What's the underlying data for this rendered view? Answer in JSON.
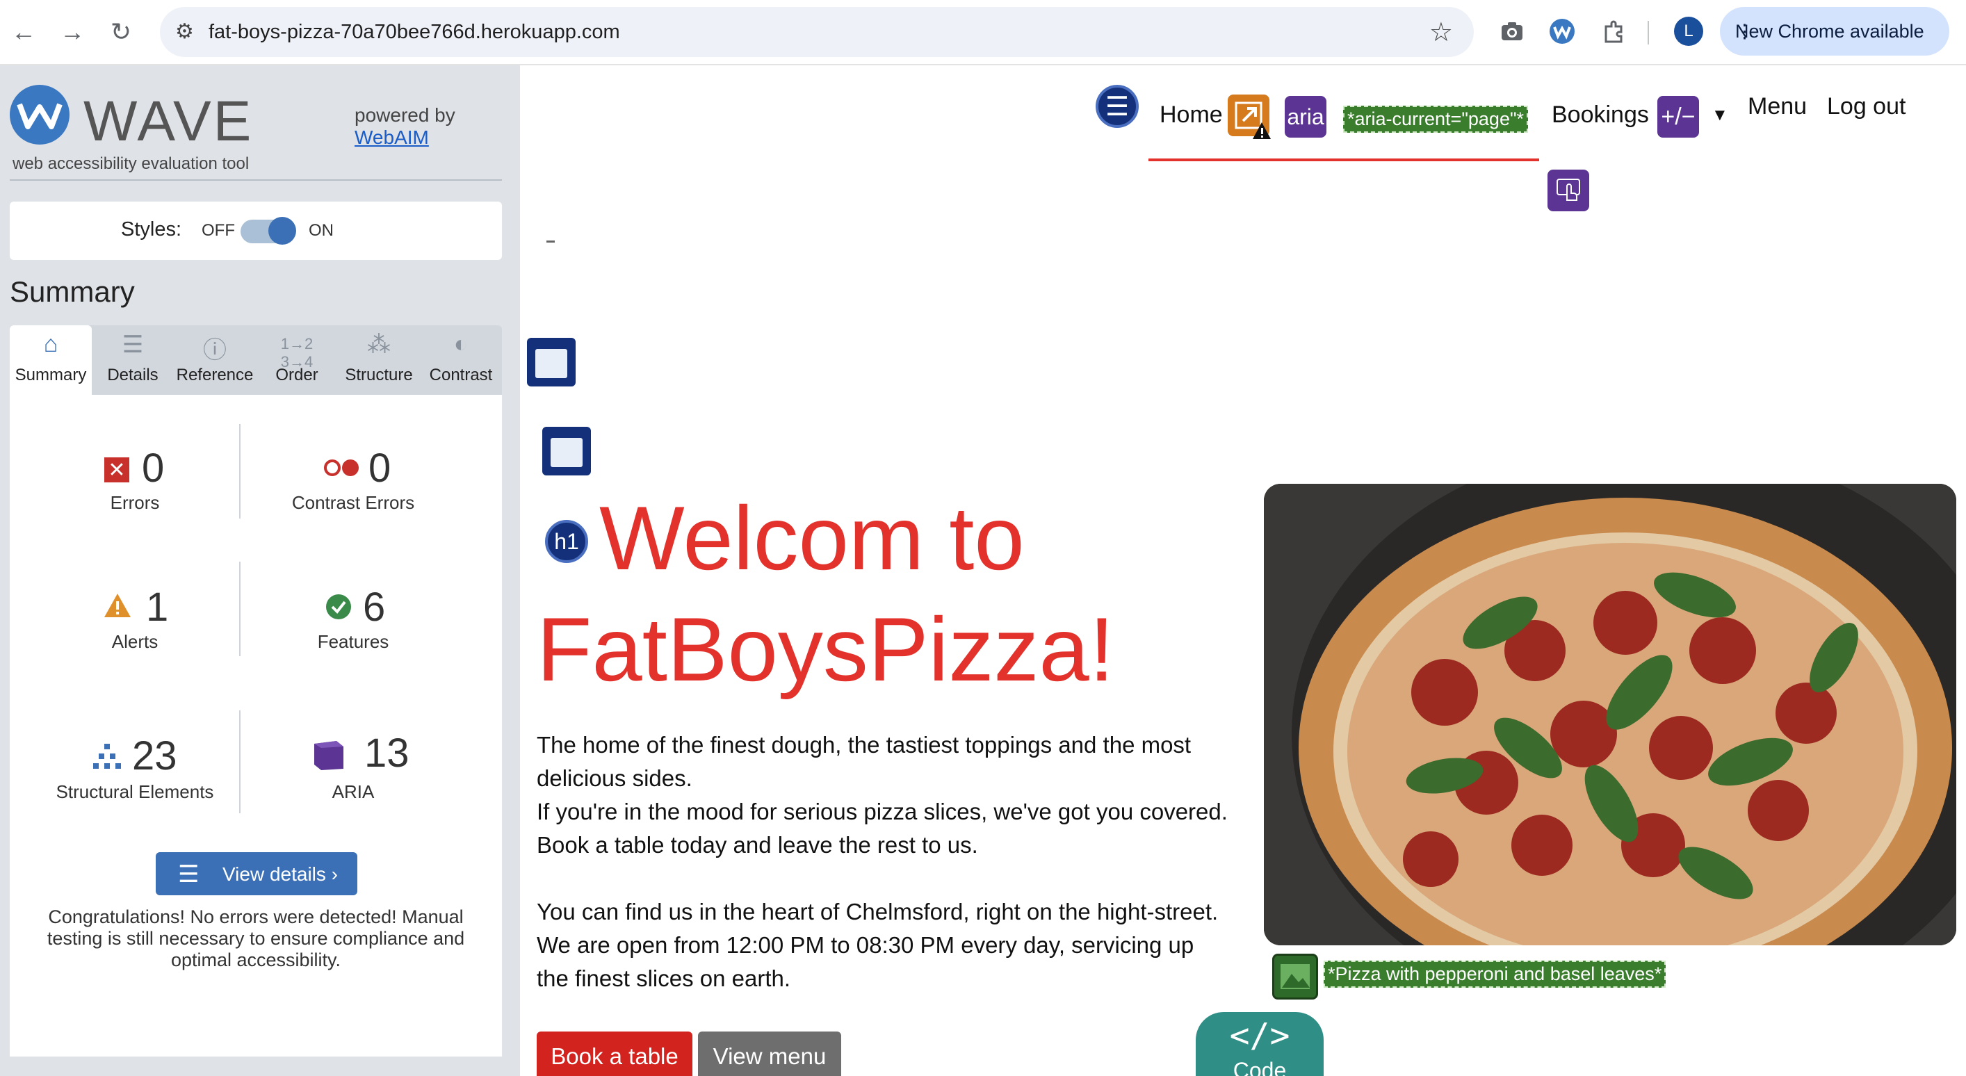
{
  "browser": {
    "url": "fat-boys-pizza-70a70bee766d.herokuapp.com",
    "profile_initial": "L",
    "update_label": "New Chrome available",
    "icons": [
      "back-icon",
      "forward-icon",
      "reload-icon",
      "site-settings-icon",
      "bookmark-star-icon",
      "screenshot-icon",
      "wave-extension-icon",
      "extensions-icon",
      "kebab-menu-icon"
    ]
  },
  "wave": {
    "title": "WAVE",
    "subtitle": "web accessibility evaluation tool",
    "powered_by": "powered by",
    "webaim": "WebAIM",
    "styles_label": "Styles:",
    "styles_off": "OFF",
    "styles_on": "ON",
    "styles_enabled": true,
    "summary_heading": "Summary",
    "tabs": [
      {
        "label": "Summary",
        "icon": "home-icon",
        "active": true
      },
      {
        "label": "Details",
        "icon": "list-icon",
        "active": false
      },
      {
        "label": "Reference",
        "icon": "info-icon",
        "active": false
      },
      {
        "label": "Order",
        "icon": "order-icon",
        "active": false
      },
      {
        "label": "Structure",
        "icon": "structure-icon",
        "active": false
      },
      {
        "label": "Contrast",
        "icon": "contrast-icon",
        "active": false
      }
    ],
    "stats": {
      "errors": {
        "count": "0",
        "label": "Errors"
      },
      "contrast_errors": {
        "count": "0",
        "label": "Contrast Errors"
      },
      "alerts": {
        "count": "1",
        "label": "Alerts"
      },
      "features": {
        "count": "6",
        "label": "Features"
      },
      "structural": {
        "count": "23",
        "label": "Structural Elements"
      },
      "aria": {
        "count": "13",
        "label": "ARIA"
      }
    },
    "view_details": "View details ›",
    "congrats": "Congratulations! No errors were detected! Manual testing is still necessary to ensure compliance and optimal accessibility.",
    "colors": {
      "accent": "#3b6fb6",
      "error": "#c8302c",
      "alert": "#e0902a",
      "feature": "#3a8a4a",
      "aria": "#5b3494"
    }
  },
  "site": {
    "nav": {
      "home": "Home",
      "aria_icon": "aria",
      "aria_current": "*aria-current=\"page\"*",
      "aria_expanded_icon": "+/−",
      "bookings": "Bookings",
      "menu": "Menu",
      "logout": "Log out"
    },
    "h1_badge": "h1",
    "hero_line1": "Welcom to",
    "hero_line2": "FatBoysPizza!",
    "paragraph1": "The home of the finest dough, the tastiest toppings and the most delicious sides.",
    "paragraph2": "If you're in the mood for serious pizza slices, we've got you covered.",
    "paragraph3": "Book a table today and leave the rest to us.",
    "paragraph4": "You can find us in the heart of Chelmsford, right on the hight-street.",
    "paragraph5": "We are open from 12:00 PM to 08:30 PM every day, servicing up the finest slices on earth.",
    "image_alt": "*Pizza with pepperoni and basel leaves*",
    "btn_book": "Book a table",
    "btn_menu": "View menu",
    "code_label": "Code",
    "code_glyph": "</>",
    "colors": {
      "brand": "#e3322c",
      "book_button": "#d2231f",
      "menu_button": "#6e6e6e"
    }
  }
}
